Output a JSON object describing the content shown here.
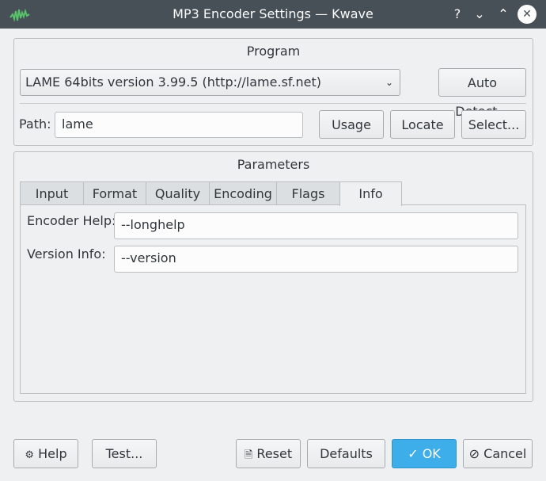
{
  "window": {
    "title": "MP3 Encoder Settings — Kwave",
    "help_btn": "?",
    "minimize_btn": "⌄",
    "maximize_btn": "⌃",
    "close_btn": "✕"
  },
  "program": {
    "group_title": "Program",
    "selected": "LAME 64bits version 3.99.5 (http://lame.sf.net)",
    "auto_detect": "Auto Detect...",
    "path_label": "Path:",
    "path_value": "lame",
    "usage": "Usage",
    "locate": "Locate",
    "select": "Select..."
  },
  "parameters": {
    "group_title": "Parameters",
    "tabs": [
      "Input",
      "Format",
      "Quality",
      "Encoding",
      "Flags",
      "Info"
    ],
    "active_tab": "Info",
    "encoder_help_label": "Encoder Help:",
    "encoder_help_value": "--longhelp",
    "version_info_label": "Version Info:",
    "version_info_value": "--version"
  },
  "buttons": {
    "help": "Help",
    "test": "Test...",
    "reset": "Reset",
    "defaults": "Defaults",
    "ok": "OK",
    "cancel": "Cancel"
  },
  "colors": {
    "titlebar": "#475057",
    "window_bg": "#eff0f1",
    "accent": "#3daee9"
  }
}
